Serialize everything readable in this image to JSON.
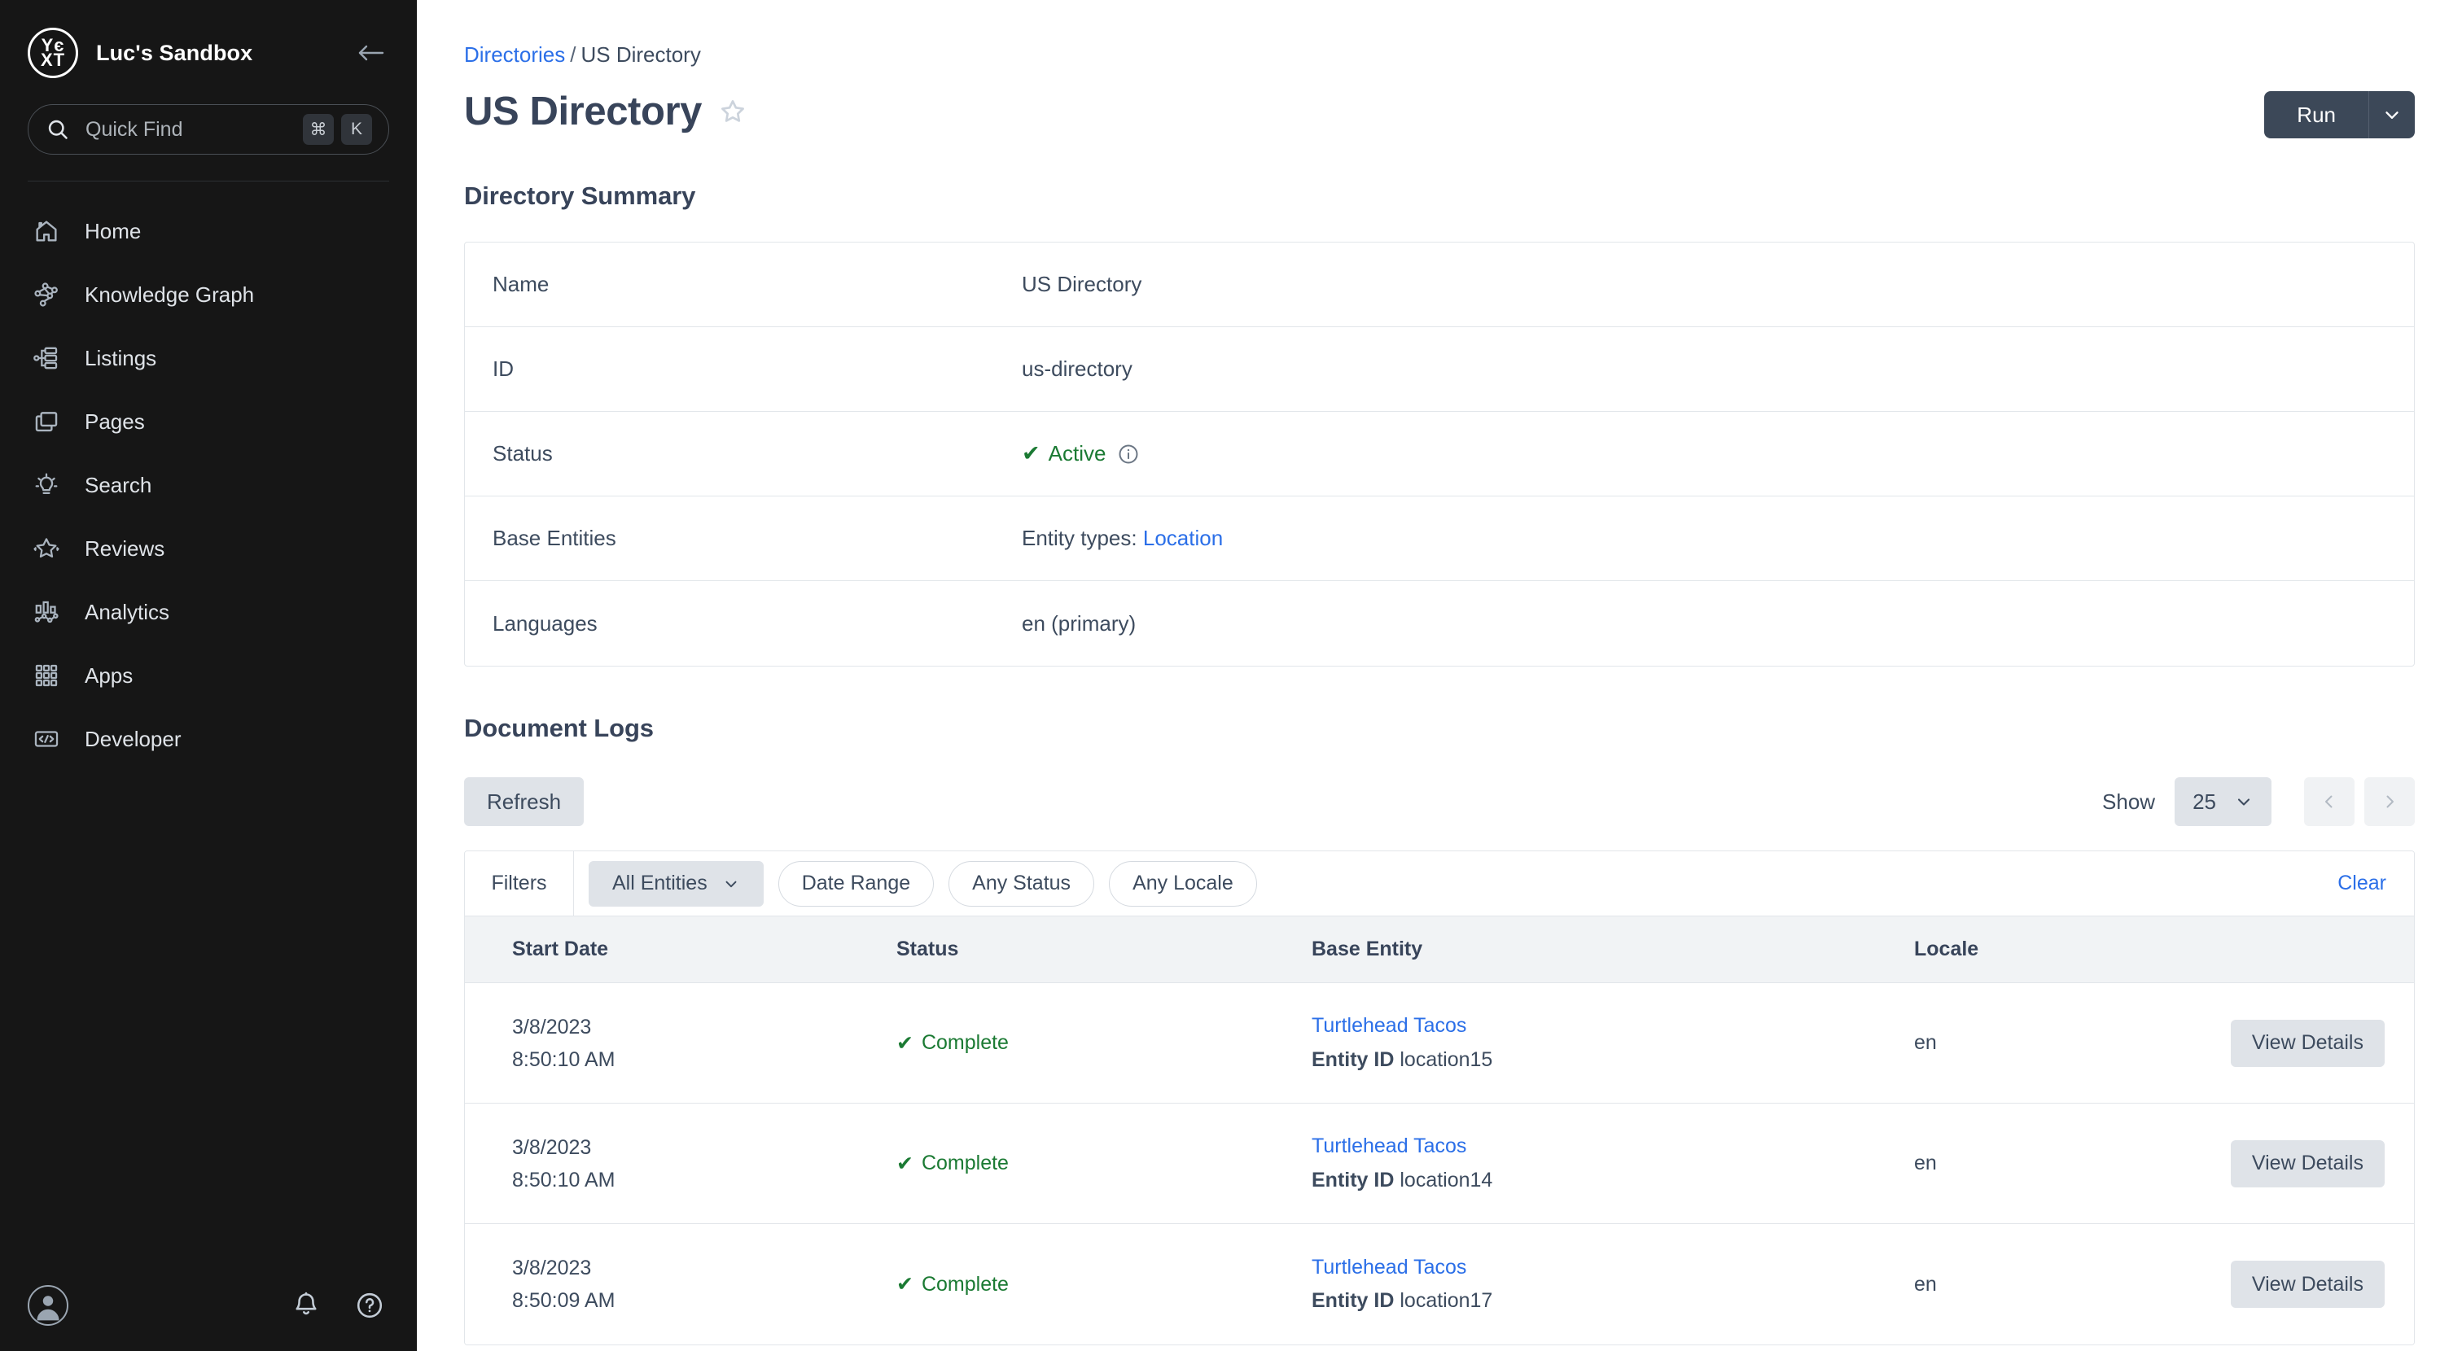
{
  "sidebar": {
    "logo_lines": [
      "Yє",
      "XT"
    ],
    "brand_name": "Luc's Sandbox",
    "collapse_icon": "arrow-left-icon",
    "quick_find": {
      "placeholder": "Quick Find",
      "icon": "search-icon",
      "shortcut_keys": [
        "⌘",
        "K"
      ]
    },
    "items": [
      {
        "label": "Home",
        "icon": "home-icon"
      },
      {
        "label": "Knowledge Graph",
        "icon": "knowledge-graph-icon"
      },
      {
        "label": "Listings",
        "icon": "listings-icon"
      },
      {
        "label": "Pages",
        "icon": "pages-icon"
      },
      {
        "label": "Search",
        "icon": "lightbulb-icon"
      },
      {
        "label": "Reviews",
        "icon": "star-icon"
      },
      {
        "label": "Analytics",
        "icon": "analytics-icon"
      },
      {
        "label": "Apps",
        "icon": "apps-grid-icon"
      },
      {
        "label": "Developer",
        "icon": "code-icon"
      }
    ],
    "bottom": {
      "avatar_icon": "user-avatar-icon",
      "notifications_icon": "bell-icon",
      "help_icon": "help-circle-icon"
    }
  },
  "header": {
    "breadcrumb_root": "Directories",
    "breadcrumb_separator": "/",
    "breadcrumb_current": "US Directory",
    "title": "US Directory",
    "favorite_icon": "star-outline-icon",
    "run_label": "Run",
    "run_caret_icon": "chevron-down-icon"
  },
  "summary": {
    "title": "Directory Summary",
    "rows": [
      {
        "label": "Name",
        "value": "US Directory",
        "type": "text"
      },
      {
        "label": "ID",
        "value": "us-directory",
        "type": "text"
      },
      {
        "label": "Status",
        "value": "Active",
        "type": "status",
        "icon": "check-icon",
        "info_icon": "info-circle-icon"
      },
      {
        "label": "Base Entities",
        "value": "Entity types:",
        "link": "Location",
        "type": "link"
      },
      {
        "label": "Languages",
        "value": "en (primary)",
        "type": "text"
      }
    ]
  },
  "logs": {
    "title": "Document Logs",
    "refresh_label": "Refresh",
    "show_label": "Show",
    "page_size": "25",
    "page_size_caret": "chevron-down-icon",
    "prev_icon": "chevron-left-icon",
    "next_icon": "chevron-right-icon",
    "filters": {
      "label": "Filters",
      "chips": [
        {
          "label": "All Entities",
          "active": true,
          "caret": "chevron-down-icon"
        },
        {
          "label": "Date Range",
          "active": false
        },
        {
          "label": "Any Status",
          "active": false
        },
        {
          "label": "Any Locale",
          "active": false
        }
      ],
      "clear_label": "Clear"
    },
    "columns": [
      "Start Date",
      "Status",
      "Base Entity",
      "Locale",
      ""
    ],
    "entity_id_label": "Entity ID",
    "view_details_label": "View Details",
    "rows": [
      {
        "date": "3/8/2023",
        "time": "8:50:10 AM",
        "status": "Complete",
        "status_icon": "check-icon",
        "entity_name": "Turtlehead Tacos",
        "entity_id": "location15",
        "locale": "en"
      },
      {
        "date": "3/8/2023",
        "time": "8:50:10 AM",
        "status": "Complete",
        "status_icon": "check-icon",
        "entity_name": "Turtlehead Tacos",
        "entity_id": "location14",
        "locale": "en"
      },
      {
        "date": "3/8/2023",
        "time": "8:50:09 AM",
        "status": "Complete",
        "status_icon": "check-icon",
        "entity_name": "Turtlehead Tacos",
        "entity_id": "location17",
        "locale": "en"
      }
    ]
  },
  "colors": {
    "sidebar_bg": "#161616",
    "link_blue": "#2b6fe8",
    "success_green": "#1b7a33",
    "dark_navy": "#38445a",
    "chip_grey": "#dfe3e8"
  }
}
